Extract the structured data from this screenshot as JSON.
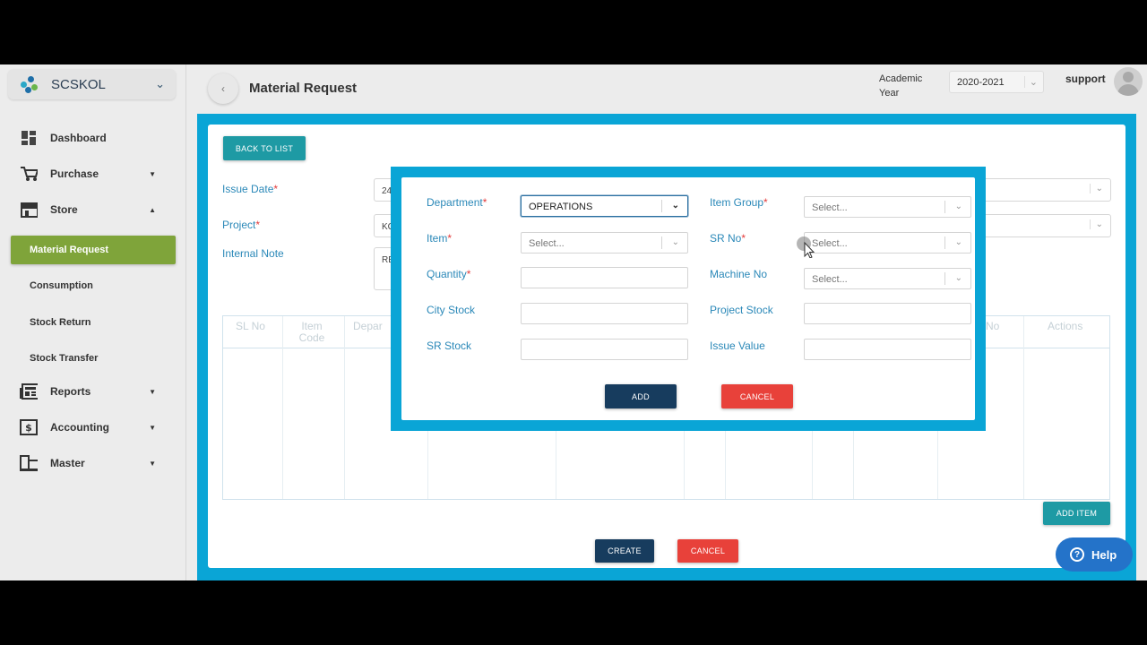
{
  "brand": {
    "name": "SCSKOL"
  },
  "sidebar": {
    "items": [
      {
        "label": "Dashboard"
      },
      {
        "label": "Purchase"
      },
      {
        "label": "Store"
      },
      {
        "label": "Reports"
      },
      {
        "label": "Accounting"
      },
      {
        "label": "Master"
      }
    ],
    "store_sub": [
      {
        "label": "Material Request"
      },
      {
        "label": "Consumption"
      },
      {
        "label": "Stock Return"
      },
      {
        "label": "Stock Transfer"
      }
    ]
  },
  "header": {
    "title": "Material Request",
    "academic_year_label": "Academic Year",
    "academic_year_value": "2020-2021",
    "user": "support"
  },
  "page": {
    "back_to_list": "BACK TO LIST",
    "issue_date_label": "Issue Date",
    "issue_date_value": "24",
    "project_label": "Project",
    "project_value": "KC",
    "internal_note_label": "Internal Note",
    "internal_note_value": "RE",
    "table_headers": [
      "SL No",
      "Item Code",
      "Depar",
      "No",
      "Actions"
    ],
    "add_item": "ADD ITEM",
    "create": "CREATE",
    "cancel": "CANCEL"
  },
  "modal": {
    "department_label": "Department",
    "department_value": "OPERATIONS",
    "item_group_label": "Item Group",
    "item_group_placeholder": "Select...",
    "item_label": "Item",
    "item_placeholder": "Select...",
    "sr_no_label": "SR No",
    "sr_no_placeholder": "Select...",
    "quantity_label": "Quantity",
    "machine_no_label": "Machine No",
    "machine_no_placeholder": "Select...",
    "city_stock_label": "City Stock",
    "project_stock_label": "Project Stock",
    "sr_stock_label": "SR Stock",
    "issue_value_label": "Issue Value",
    "required_mark": "*",
    "add": "ADD",
    "cancel": "CANCEL"
  },
  "help": {
    "label": "Help"
  },
  "colors": {
    "accent": "#0aa5d6",
    "active_nav": "#7fa43a",
    "navy": "#173c5e",
    "danger": "#e8413a",
    "teal": "#1e9aa4"
  }
}
